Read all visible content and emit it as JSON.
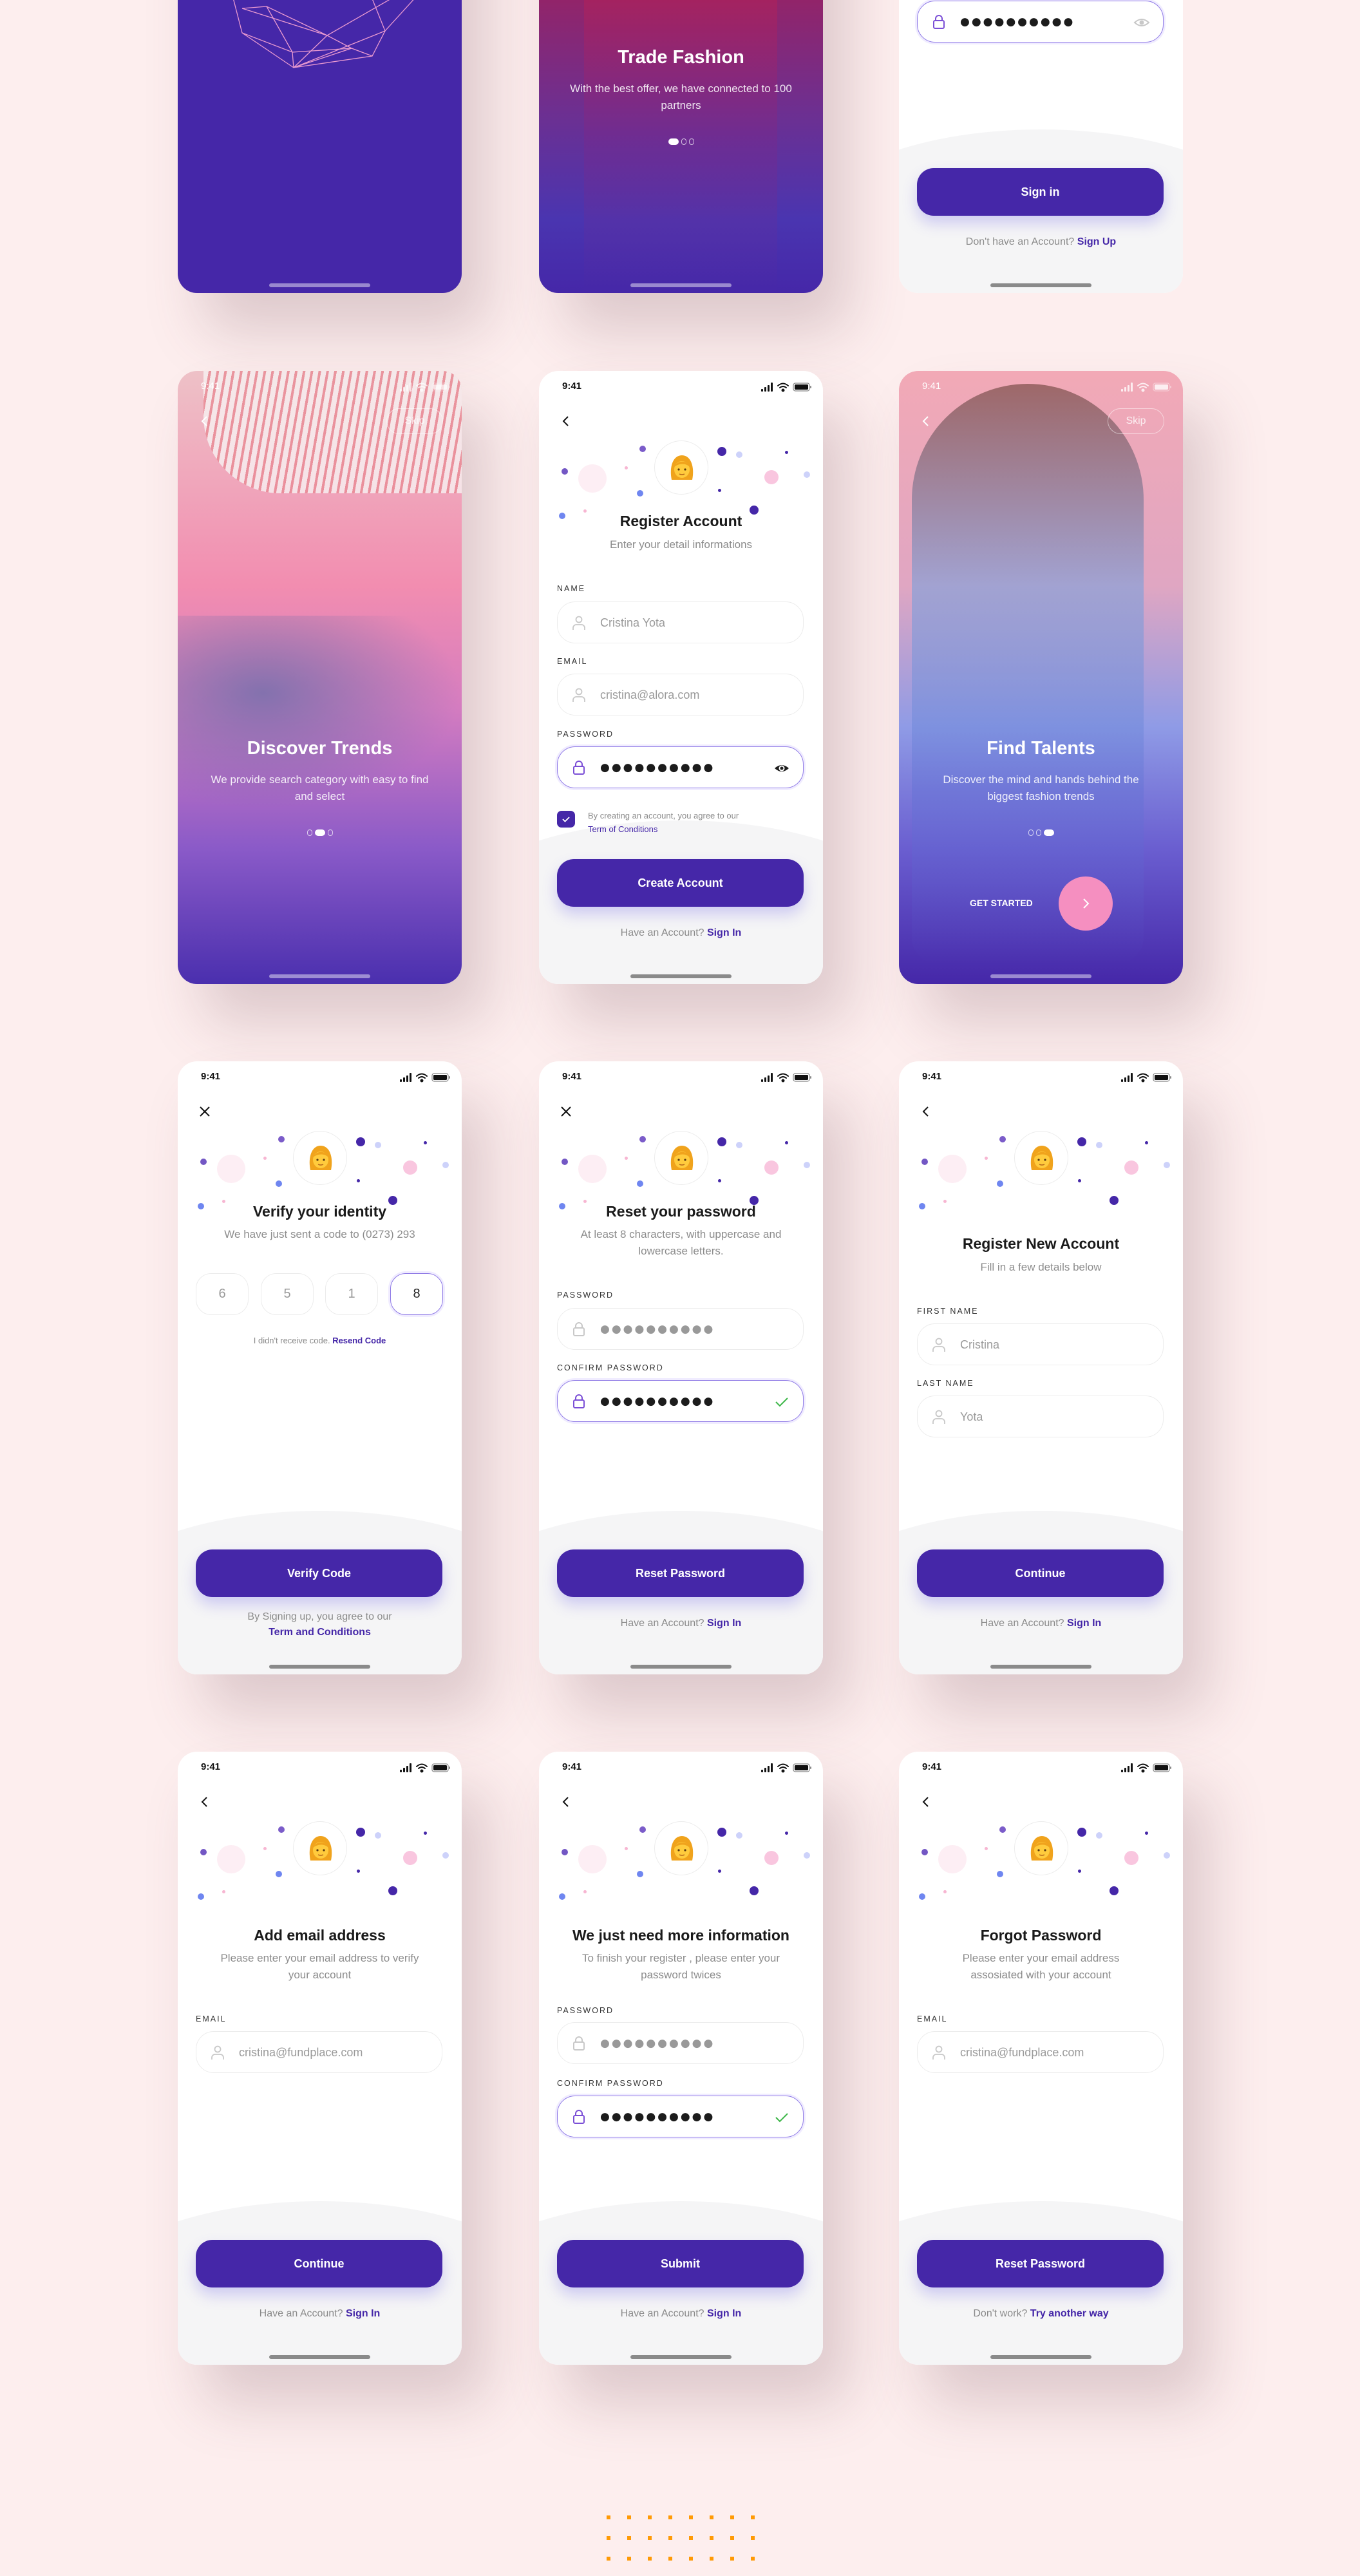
{
  "status_bar": {
    "time": "9:41"
  },
  "password_mask": "●●●●●●●●●●",
  "colors": {
    "brand": "#4527a8",
    "accent_pink": "#f58fc0",
    "success": "#3cb648",
    "background": "#fdeeee",
    "decor_squares": "#ff9a05"
  },
  "screens": {
    "splash": {},
    "trade_fashion": {
      "title": "Trade Fashion",
      "subtitle": "With the best offer, we have connected to 100 partners",
      "pagination": {
        "count": 3,
        "active": 1
      }
    },
    "sign_in": {
      "button": "Sign in",
      "footer_text": "Don't have an Account?",
      "footer_link": "Sign Up"
    },
    "discover_trends": {
      "title": "Discover Trends",
      "subtitle": "We provide search category with easy to find and select",
      "skip": "Skip",
      "pagination": {
        "count": 3,
        "active": 2
      }
    },
    "register_account": {
      "title": "Register Account",
      "subtitle": "Enter your detail informations",
      "name_label": "NAME",
      "name_value": "Cristina Yota",
      "email_label": "EMAIL",
      "email_value": "cristina@alora.com",
      "password_label": "PASSWORD",
      "agree_text": "By creating an account, you agree to our",
      "agree_link": "Term of Conditions",
      "agree_checked": true,
      "button": "Create Account",
      "footer_text": "Have an Account?",
      "footer_link": "Sign In"
    },
    "find_talents": {
      "title": "Find Talents",
      "subtitle": "Discover the mind and hands behind the biggest fashion trends",
      "skip": "Skip",
      "get_started": "GET STARTED",
      "pagination": {
        "count": 3,
        "active": 3
      }
    },
    "verify_identity": {
      "title": "Verify your identity",
      "subtitle": "We have just sent a code to (0273) 293",
      "code": [
        "6",
        "5",
        "1",
        "8"
      ],
      "resend_text": "I didn't receive code.",
      "resend_link": "Resend Code",
      "button": "Verify Code",
      "footer_text": "By Signing up, you agree to our",
      "footer_link": "Term and Conditions"
    },
    "reset_password": {
      "title": "Reset your password",
      "subtitle": "At least 8 characters, with uppercase and lowercase letters.",
      "password_label": "PASSWORD",
      "confirm_label": "CONFIRM PASSWORD",
      "button": "Reset Password",
      "footer_text": "Have an Account?",
      "footer_link": "Sign In"
    },
    "register_new_account": {
      "title": "Register New Account",
      "subtitle": "Fill in a few details below",
      "first_name_label": "FIRST NAME",
      "first_name_value": "Cristina",
      "last_name_label": "LAST NAME",
      "last_name_value": "Yota",
      "button": "Continue",
      "footer_text": "Have an Account?",
      "footer_link": "Sign In"
    },
    "add_email": {
      "title": "Add email address",
      "subtitle": "Please enter your email address to verify your account",
      "email_label": "EMAIL",
      "email_value": "cristina@fundplace.com",
      "button": "Continue",
      "footer_text": "Have an Account?",
      "footer_link": "Sign In"
    },
    "more_info": {
      "title": "We just need more information",
      "subtitle": "To finish your register , please enter your password twices",
      "password_label": "PASSWORD",
      "confirm_label": "CONFIRM PASSWORD",
      "button": "Submit",
      "footer_text": "Have an Account?",
      "footer_link": "Sign In"
    },
    "forgot_password": {
      "title": "Forgot Password",
      "subtitle": "Please enter your email address assosiated with your account",
      "email_label": "EMAIL",
      "email_value": "cristina@fundplace.com",
      "button": "Reset Password",
      "footer_text": "Don't work?",
      "footer_link": "Try another way"
    }
  }
}
